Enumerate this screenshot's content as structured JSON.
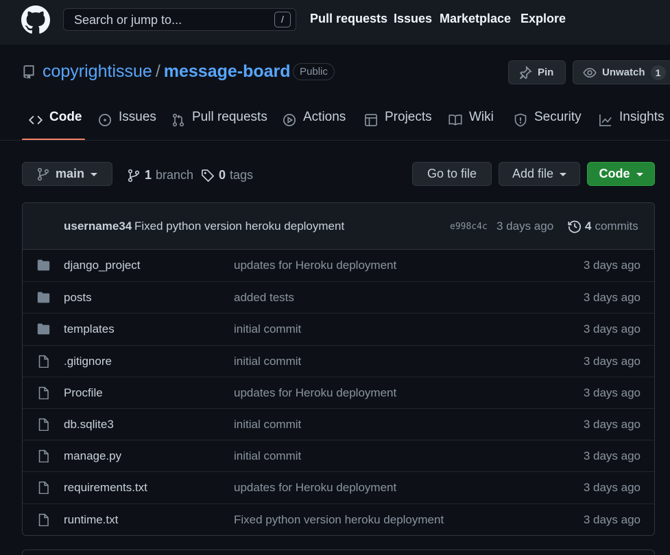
{
  "header": {
    "search_placeholder": "Search or jump to...",
    "search_shortcut": "/",
    "nav": [
      "Pull requests",
      "Issues",
      "Marketplace",
      "Explore"
    ]
  },
  "repo": {
    "owner": "copyrightissue",
    "separator": "/",
    "name": "message-board",
    "visibility": "Public",
    "pin_label": "Pin",
    "unwatch_label": "Unwatch",
    "watch_count": "1"
  },
  "tabs": [
    {
      "label": "Code",
      "icon": "code-icon"
    },
    {
      "label": "Issues",
      "icon": "issue-icon"
    },
    {
      "label": "Pull requests",
      "icon": "pull-request-icon"
    },
    {
      "label": "Actions",
      "icon": "play-icon"
    },
    {
      "label": "Projects",
      "icon": "table-icon"
    },
    {
      "label": "Wiki",
      "icon": "book-icon"
    },
    {
      "label": "Security",
      "icon": "shield-icon"
    },
    {
      "label": "Insights",
      "icon": "graph-icon"
    }
  ],
  "branch_bar": {
    "branch": "main",
    "branch_count": "1",
    "branch_label": "branch",
    "tag_count": "0",
    "tag_label": "tags",
    "go_to_file": "Go to file",
    "add_file": "Add file",
    "code": "Code"
  },
  "latest_commit": {
    "author": "username34",
    "message": "Fixed python version heroku deployment",
    "sha": "e998c4c",
    "time": "3 days ago",
    "commit_count": "4",
    "commit_label": "commits"
  },
  "files": [
    {
      "type": "folder",
      "name": "django_project",
      "message": "updates for Heroku deployment",
      "age": "3 days ago"
    },
    {
      "type": "folder",
      "name": "posts",
      "message": "added tests",
      "age": "3 days ago"
    },
    {
      "type": "folder",
      "name": "templates",
      "message": "initial commit",
      "age": "3 days ago"
    },
    {
      "type": "file",
      "name": ".gitignore",
      "message": "initial commit",
      "age": "3 days ago"
    },
    {
      "type": "file",
      "name": "Procfile",
      "message": "updates for Heroku deployment",
      "age": "3 days ago"
    },
    {
      "type": "file",
      "name": "db.sqlite3",
      "message": "initial commit",
      "age": "3 days ago"
    },
    {
      "type": "file",
      "name": "manage.py",
      "message": "initial commit",
      "age": "3 days ago"
    },
    {
      "type": "file",
      "name": "requirements.txt",
      "message": "updates for Heroku deployment",
      "age": "3 days ago"
    },
    {
      "type": "file",
      "name": "runtime.txt",
      "message": "Fixed python version heroku deployment",
      "age": "3 days ago"
    }
  ],
  "colors": {
    "background": "#0d1117",
    "header": "#161b22",
    "link": "#58a6ff",
    "primary_button": "#238636",
    "tab_underline": "#f78166"
  }
}
